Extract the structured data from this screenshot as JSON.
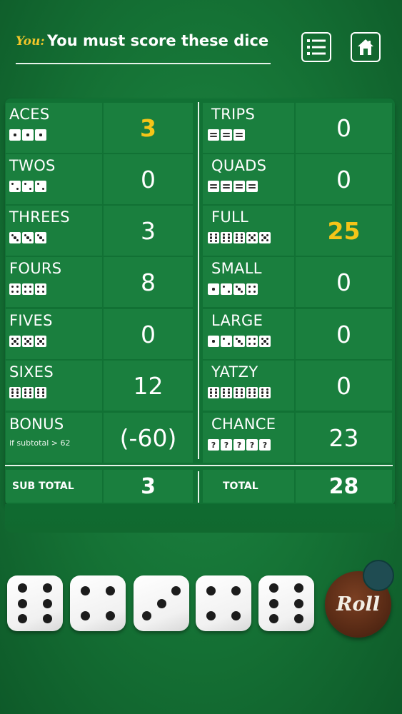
{
  "header": {
    "player_label": "You:",
    "message": "You must score these dice"
  },
  "icons": {
    "list": "list-icon",
    "home": "home-icon"
  },
  "colors": {
    "highlight": "#f5c518",
    "background": "#157235",
    "cell": "#1a7f3e"
  },
  "upper": [
    {
      "name": "ACES",
      "value": "3",
      "highlight": true,
      "dice": [
        1,
        1,
        1
      ]
    },
    {
      "name": "TWOS",
      "value": "0",
      "highlight": false,
      "dice": [
        2,
        2,
        2
      ]
    },
    {
      "name": "THREES",
      "value": "3",
      "highlight": false,
      "dice": [
        3,
        3,
        3
      ]
    },
    {
      "name": "FOURS",
      "value": "8",
      "highlight": false,
      "dice": [
        4,
        4,
        4
      ]
    },
    {
      "name": "FIVES",
      "value": "0",
      "highlight": false,
      "dice": [
        5,
        5,
        5
      ]
    },
    {
      "name": "SIXES",
      "value": "12",
      "highlight": false,
      "dice": [
        6,
        6,
        6
      ]
    },
    {
      "name": "BONUS",
      "value": "(-60)",
      "highlight": false,
      "subtext": "if subtotal > 62"
    }
  ],
  "lower": [
    {
      "name": "TRIPS",
      "value": "0",
      "highlight": false,
      "dice": [
        "=",
        "=",
        "="
      ]
    },
    {
      "name": "QUADS",
      "value": "0",
      "highlight": false,
      "dice": [
        "=",
        "=",
        "=",
        "="
      ]
    },
    {
      "name": "FULL",
      "value": "25",
      "highlight": true,
      "dice": [
        6,
        6,
        6,
        5,
        5
      ]
    },
    {
      "name": "SMALL",
      "value": "0",
      "highlight": false,
      "dice": [
        1,
        2,
        3,
        4
      ]
    },
    {
      "name": "LARGE",
      "value": "0",
      "highlight": false,
      "dice": [
        1,
        2,
        3,
        4,
        5
      ]
    },
    {
      "name": "YATZY",
      "value": "0",
      "highlight": false,
      "dice": [
        6,
        6,
        6,
        6,
        6
      ]
    },
    {
      "name": "CHANCE",
      "value": "23",
      "highlight": false,
      "dice": [
        "?",
        "?",
        "?",
        "?",
        "?"
      ]
    }
  ],
  "totals": {
    "subtotal_label": "SUB TOTAL",
    "subtotal_value": "3",
    "total_label": "TOTAL",
    "total_value": "28"
  },
  "dice": [
    6,
    4,
    3,
    4,
    6
  ],
  "roll_label": "Roll"
}
